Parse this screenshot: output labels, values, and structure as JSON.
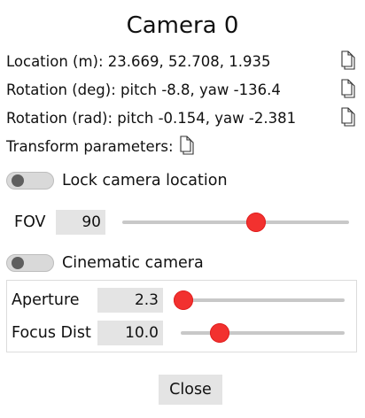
{
  "dialog": {
    "title": "Camera 0",
    "location_text": "Location (m): 23.669, 52.708, 1.935",
    "rotation_deg_text": "Rotation (deg): pitch -8.8, yaw -136.4",
    "rotation_rad_text": "Rotation (rad): pitch -0.154, yaw -2.381",
    "transform_params_text": "Transform parameters:",
    "copy_icon": "copy-document-icon"
  },
  "lock_camera": {
    "label": "Lock camera location",
    "checked": false
  },
  "fov": {
    "label": "FOV",
    "value": "90",
    "slider_fraction": 0.6
  },
  "cinematic": {
    "label": "Cinematic camera",
    "checked": false
  },
  "aperture": {
    "label": "Aperture",
    "value": "2.3",
    "slider_fraction": 0.0
  },
  "focus_dist": {
    "label": "Focus Dist",
    "value": "10.0",
    "slider_fraction": 0.2
  },
  "footer": {
    "close_label": "Close"
  },
  "colors": {
    "slider_thumb": "#f2312f",
    "field_bg": "#e4e4e4",
    "toggle_knob": "#5f5f5f"
  }
}
